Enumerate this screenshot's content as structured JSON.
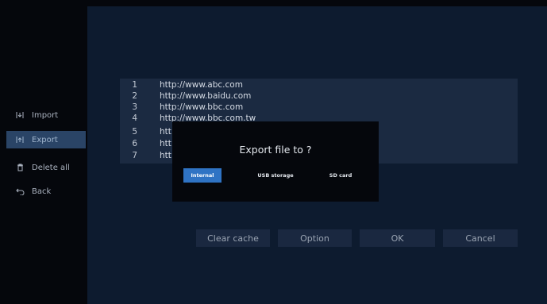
{
  "sidebar": {
    "items": [
      {
        "label": "Import",
        "icon": "import-icon"
      },
      {
        "label": "Export",
        "icon": "export-icon"
      },
      {
        "label": "Delete all",
        "icon": "trash-icon"
      },
      {
        "label": "Back",
        "icon": "back-icon"
      }
    ],
    "selected": "Export"
  },
  "url_list": [
    {
      "num": "1",
      "url": "http://www.abc.com"
    },
    {
      "num": "2",
      "url": "http://www.baidu.com"
    },
    {
      "num": "3",
      "url": "http://www.bbc.com"
    },
    {
      "num": "4",
      "url": "http://www.bbc.com.tw"
    },
    {
      "num": "5",
      "url": "htt"
    },
    {
      "num": "6",
      "url": "htt"
    },
    {
      "num": "7",
      "url": "htt"
    }
  ],
  "buttons": {
    "clear_cache": "Clear cache",
    "option": "Option",
    "ok": "OK",
    "cancel": "Cancel"
  },
  "dialog": {
    "title": "Export file to ?",
    "options": [
      "Internal",
      "USB storage",
      "SD card"
    ],
    "selected": "Internal"
  },
  "colors": {
    "background": "#0d1b2f",
    "sidebar": "#05070c",
    "accent": "#2f73c4",
    "selected_item": "#2a4466"
  }
}
